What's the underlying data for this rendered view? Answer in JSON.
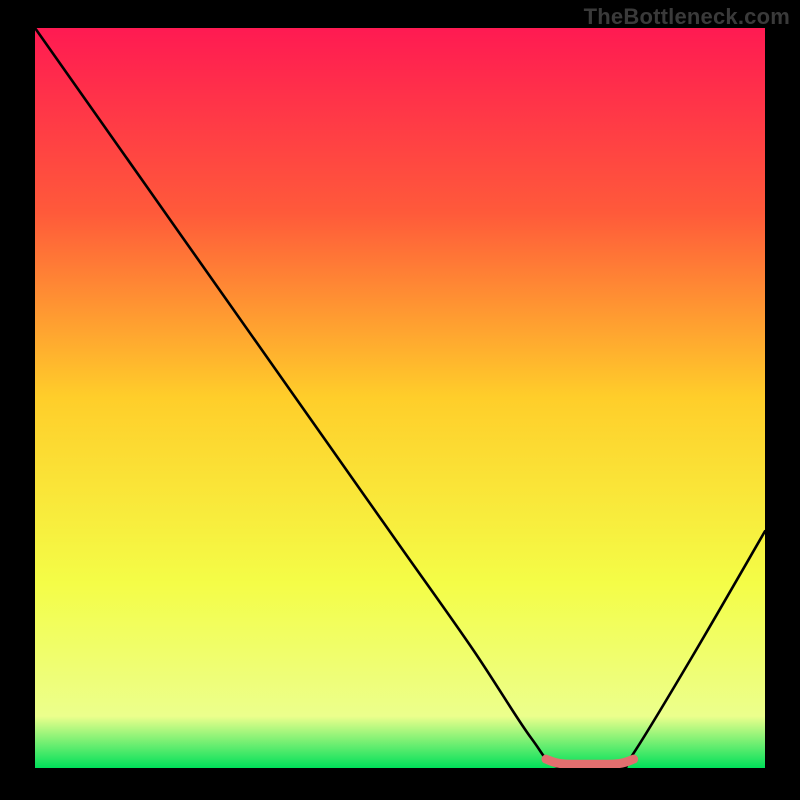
{
  "watermark": "TheBottleneck.com",
  "chart_data": {
    "type": "line",
    "title": "",
    "xlabel": "",
    "ylabel": "",
    "xlim": [
      0,
      100
    ],
    "ylim": [
      0,
      100
    ],
    "grid": false,
    "series": [
      {
        "name": "bottleneck-curve",
        "x": [
          0,
          10,
          20,
          30,
          40,
          50,
          60,
          68,
          72,
          80,
          82,
          90,
          100
        ],
        "values": [
          100,
          86,
          72,
          58,
          44,
          30,
          16,
          4,
          0,
          0,
          2,
          15,
          32
        ]
      },
      {
        "name": "optimal-band",
        "x": [
          70,
          72,
          76,
          80,
          82
        ],
        "values": [
          1.2,
          0.6,
          0.5,
          0.6,
          1.2
        ]
      }
    ],
    "background": {
      "type": "vertical-gradient",
      "stops": [
        {
          "pos": 0,
          "color": "#ff1a52"
        },
        {
          "pos": 25,
          "color": "#ff5a3a"
        },
        {
          "pos": 50,
          "color": "#ffce2a"
        },
        {
          "pos": 75,
          "color": "#f4fd47"
        },
        {
          "pos": 93,
          "color": "#ecff8c"
        },
        {
          "pos": 100,
          "color": "#00e05a"
        }
      ]
    },
    "colors": {
      "curve": "#000000",
      "optimal_marker": "#e26f6f"
    }
  }
}
